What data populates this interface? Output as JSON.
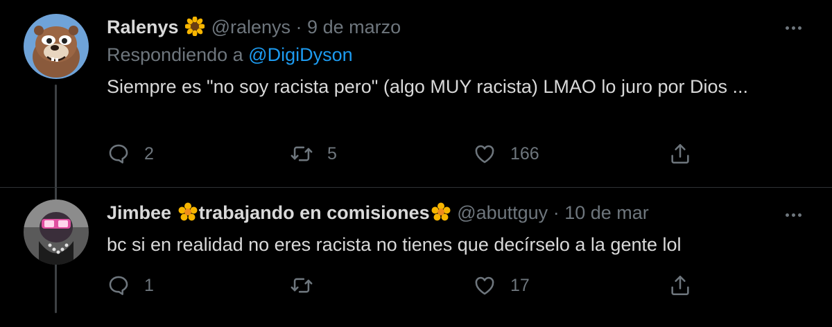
{
  "tweets": [
    {
      "name": "Ralenys",
      "handle": "@ralenys",
      "date": "9 de marzo",
      "replying_prefix": "Respondiendo a ",
      "replying_to": "@DigiDyson",
      "text": "Siempre es \"no soy racista pero\" (algo MUY racista) LMAO lo juro por Dios ...",
      "replies": "2",
      "retweets": "5",
      "likes": "166",
      "name_emoji": "sunflower-emoji"
    },
    {
      "name": "Jimbee",
      "name_suffix": "trabajando en comisiones",
      "handle": "@abuttguy",
      "date": "10 de mar",
      "text": "bc si en realidad no eres racista no tienes que decírselo a la gente lol",
      "replies": "1",
      "retweets": "",
      "likes": "17",
      "name_emoji": "blossom-emoji"
    }
  ],
  "separator": " · ",
  "colors": {
    "background": "#000000",
    "text": "#d9d9d9",
    "muted": "#6e767d",
    "link": "#1d9bf0"
  }
}
